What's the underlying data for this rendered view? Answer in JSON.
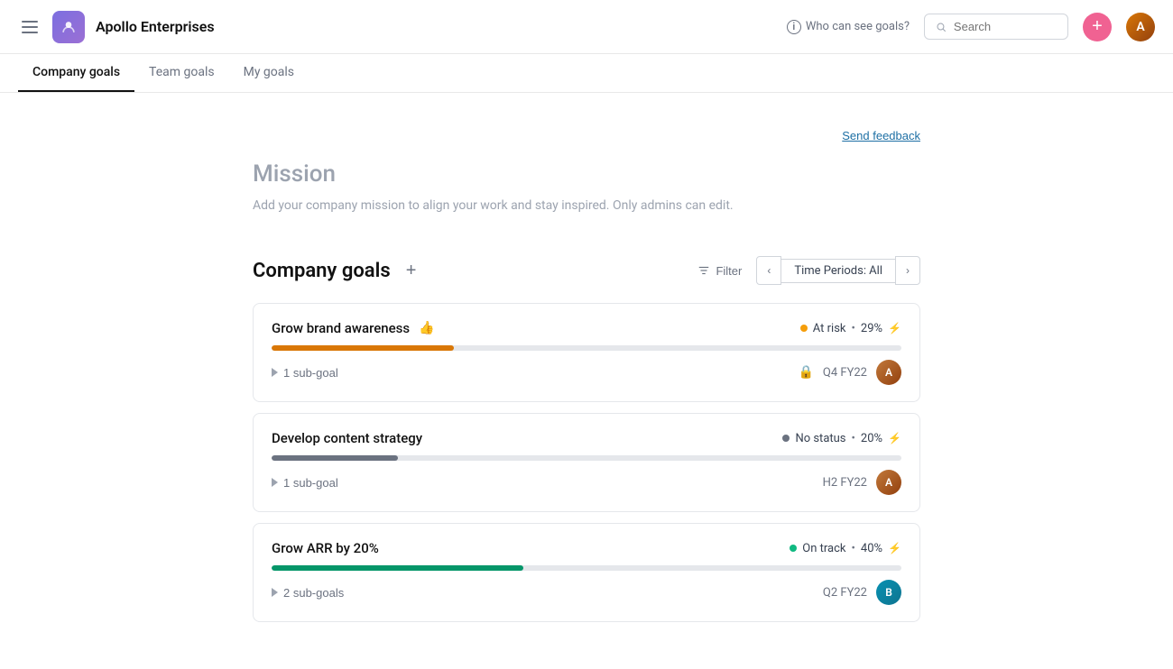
{
  "header": {
    "app_name": "Apollo Enterprises",
    "who_can_see_label": "Who can see goals?",
    "search_placeholder": "Search",
    "add_btn_label": "+",
    "info_icon_label": "i"
  },
  "nav": {
    "tabs": [
      {
        "id": "company-goals",
        "label": "Company goals",
        "active": true
      },
      {
        "id": "team-goals",
        "label": "Team goals",
        "active": false
      },
      {
        "id": "my-goals",
        "label": "My goals",
        "active": false
      }
    ]
  },
  "feedback": {
    "send_feedback_label": "Send feedback"
  },
  "mission": {
    "title": "Mission",
    "description": "Add your company mission to align your work and stay inspired. Only admins can edit."
  },
  "goals_section": {
    "title": "Company goals",
    "add_btn_label": "+",
    "filter_label": "Filter",
    "time_period": {
      "label": "Time Periods: All",
      "prev_label": "<",
      "next_label": ">"
    },
    "goals": [
      {
        "id": "goal-1",
        "name": "Grow brand awareness",
        "status": "At risk",
        "status_type": "at-risk",
        "percent": "29%",
        "progress_width": 29,
        "progress_color": "fill-yellow",
        "subgoals": "1 sub-goal",
        "period": "Q4 FY22",
        "avatar_class": "avatar-brown",
        "avatar_initials": "A",
        "has_lock": true,
        "show_bolt": true
      },
      {
        "id": "goal-2",
        "name": "Develop content strategy",
        "status": "No status",
        "status_type": "no-status",
        "percent": "20%",
        "progress_width": 20,
        "progress_color": "fill-gray",
        "subgoals": "1 sub-goal",
        "period": "H2 FY22",
        "avatar_class": "avatar-brown",
        "avatar_initials": "A",
        "has_lock": false,
        "show_bolt": true
      },
      {
        "id": "goal-3",
        "name": "Grow ARR by 20%",
        "status": "On track",
        "status_type": "on-track",
        "percent": "40%",
        "progress_width": 40,
        "progress_color": "fill-green",
        "subgoals": "2 sub-goals",
        "period": "Q2 FY22",
        "avatar_class": "avatar-teal",
        "avatar_initials": "B",
        "has_lock": false,
        "show_bolt": true
      }
    ]
  }
}
